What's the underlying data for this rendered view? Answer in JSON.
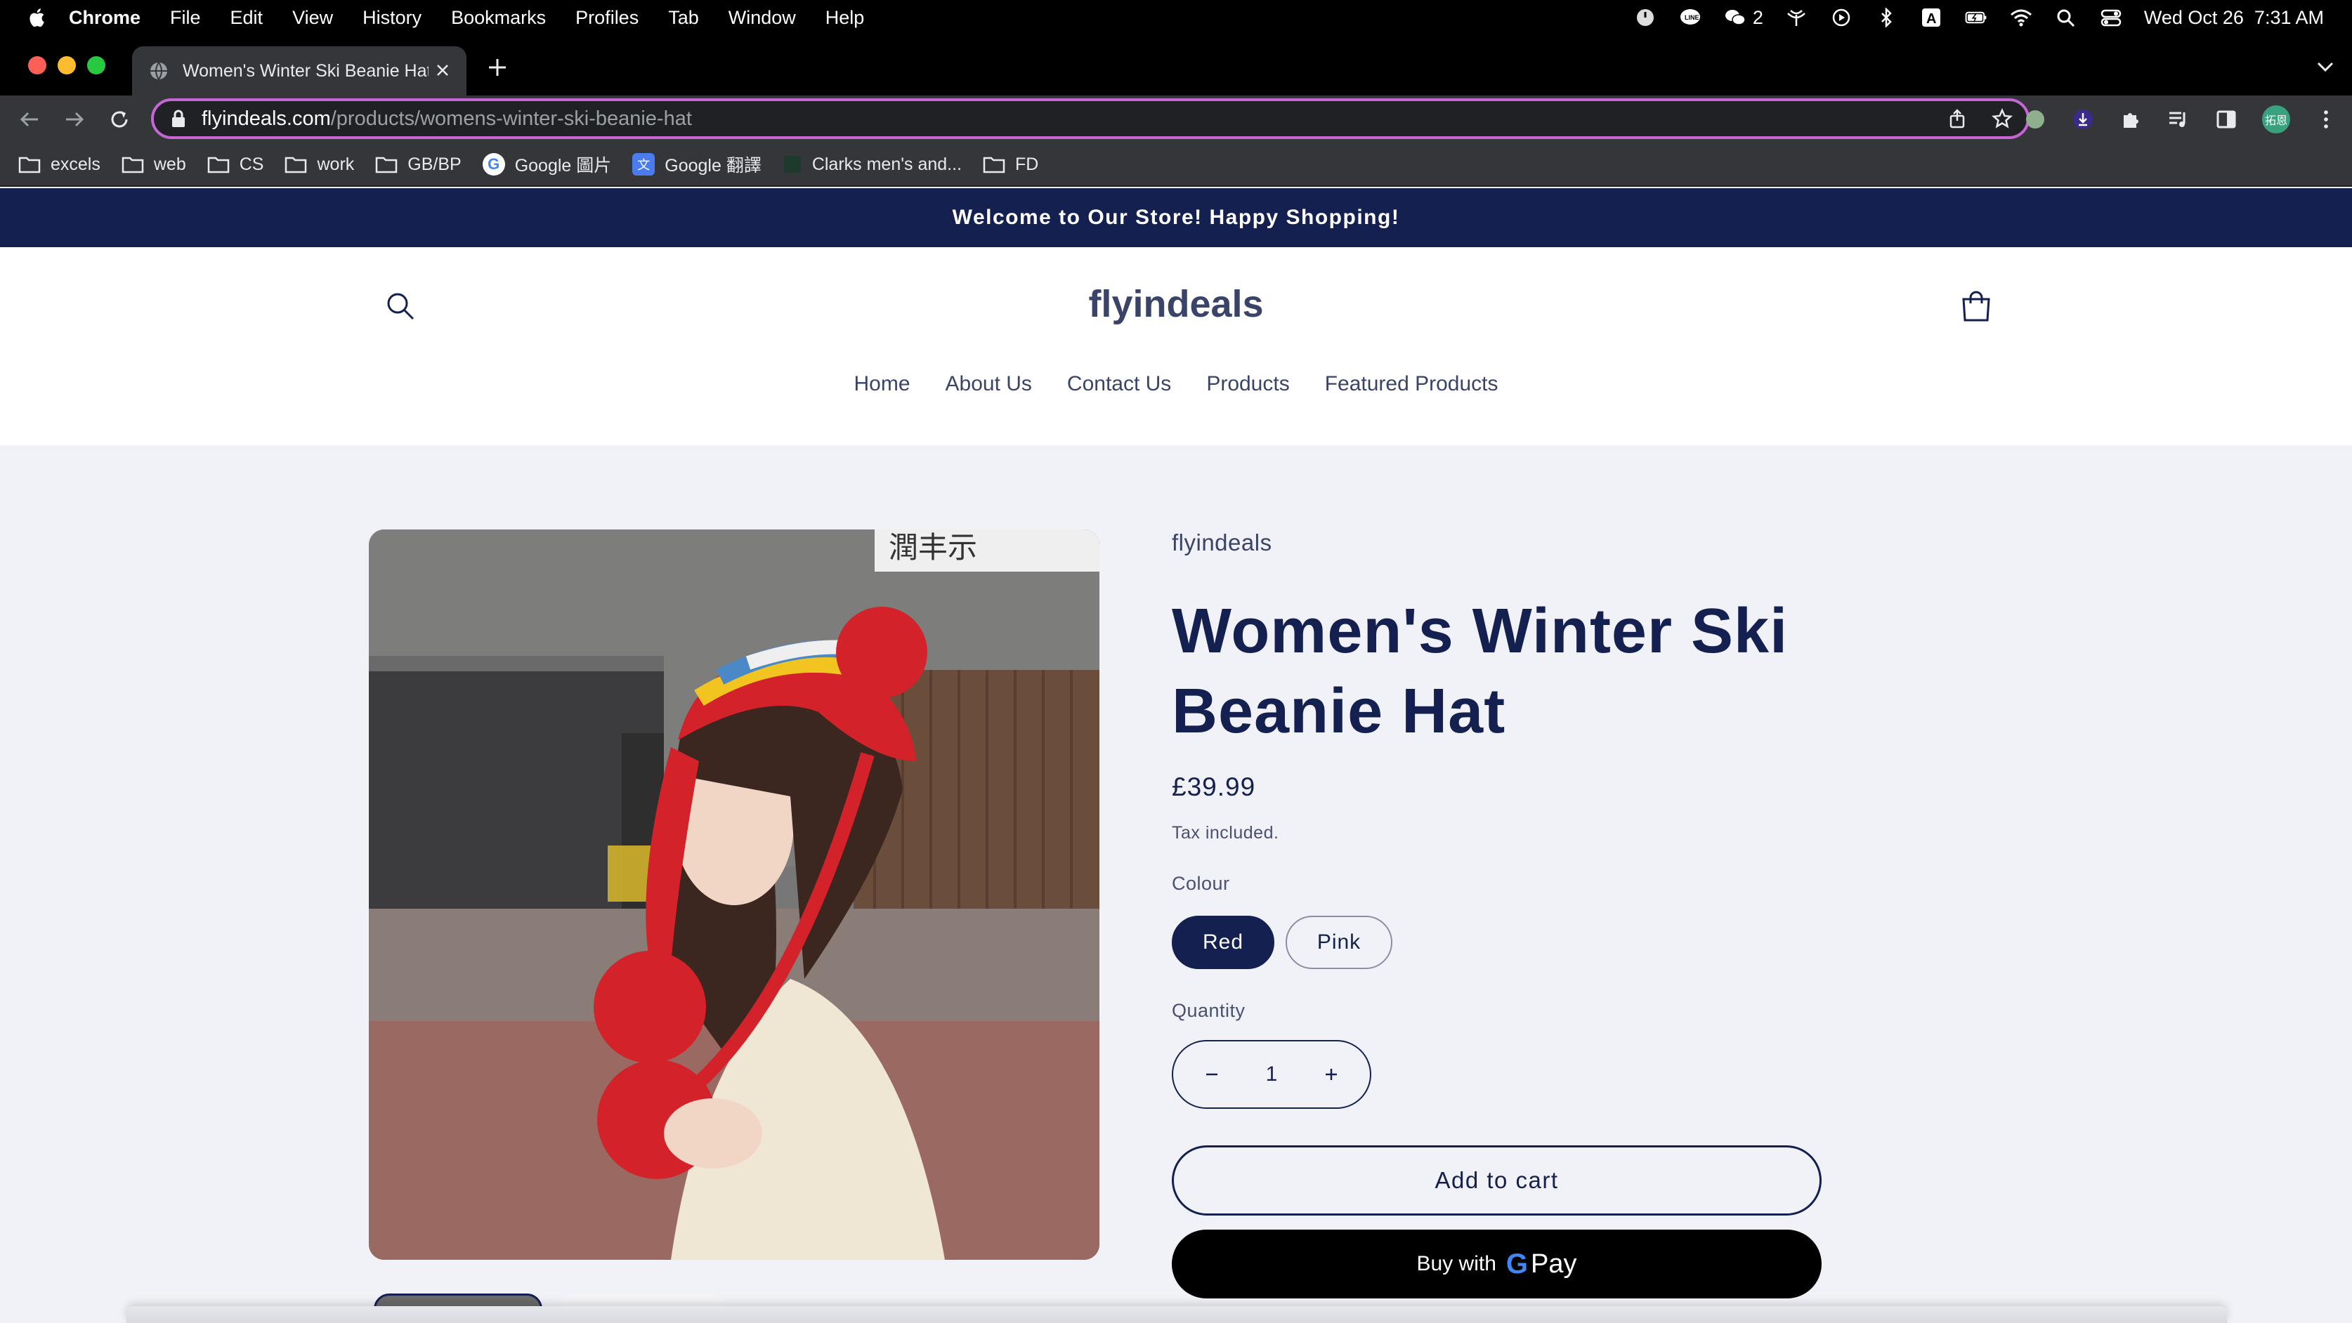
{
  "os_menubar": {
    "app": "Chrome",
    "menus": [
      "File",
      "Edit",
      "View",
      "History",
      "Bookmarks",
      "Profiles",
      "Tab",
      "Window",
      "Help"
    ],
    "wechat_count": "2",
    "datetime": "Wed Oct 26  7:31 AM"
  },
  "browser": {
    "tab_title": "Women's Winter Ski Beanie Hat",
    "url_domain": "flyindeals.com",
    "url_path": "/products/womens-winter-ski-beanie-hat",
    "profile_badge": "拓恩",
    "bookmarks": [
      "excels",
      "web",
      "CS",
      "work",
      "GB/BP",
      "Google 圖片",
      "Google 翻譯",
      "Clarks men's and...",
      "FD"
    ]
  },
  "store": {
    "announcement": "Welcome to Our Store! Happy Shopping!",
    "logo": "flyindeals",
    "nav": [
      "Home",
      "About Us",
      "Contact Us",
      "Products",
      "Featured Products"
    ]
  },
  "product": {
    "vendor": "flyindeals",
    "title": "Women's Winter Ski Beanie Hat",
    "price": "£39.99",
    "tax_note": "Tax included.",
    "option_label": "Colour",
    "options": [
      "Red",
      "Pink"
    ],
    "selected_option": "Red",
    "quantity_label": "Quantity",
    "quantity": "1",
    "add_to_cart": "Add to cart",
    "buy_with": "Buy with",
    "gpay_pay": "Pay",
    "gpay_g": "G",
    "photo_sign_text": "潤丰示"
  },
  "colors": {
    "announcement_bg": "#142050",
    "primary": "#142050",
    "page_bg": "#f1f2f7",
    "omnibox_border": "#c466d4"
  }
}
